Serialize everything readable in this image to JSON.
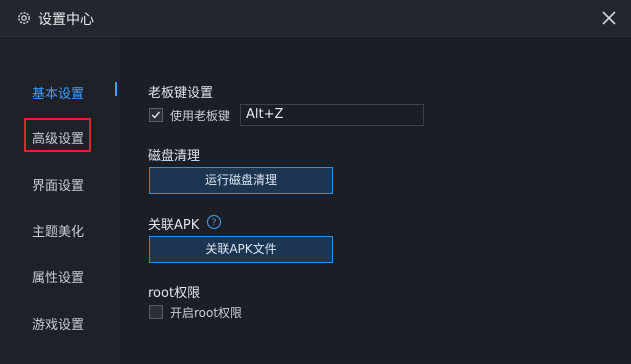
{
  "window": {
    "title": "设置中心",
    "icons": {
      "title": "gear-icon",
      "close": "close-icon"
    }
  },
  "sidebar": {
    "items": [
      {
        "label": "基本设置",
        "active": true
      },
      {
        "label": "高级设置",
        "active": false,
        "highlighted": true
      },
      {
        "label": "界面设置",
        "active": false
      },
      {
        "label": "主题美化",
        "active": false
      },
      {
        "label": "属性设置",
        "active": false
      },
      {
        "label": "游戏设置",
        "active": false
      }
    ]
  },
  "boss_key": {
    "section_title": "老板键设置",
    "checkbox_label": "使用老板键",
    "checked": true,
    "hotkey_value": "Alt+Z"
  },
  "disk_clean": {
    "section_title": "磁盘清理",
    "button_label": "运行磁盘清理"
  },
  "apk": {
    "section_title": "关联APK",
    "help_icon": "question-circle-icon",
    "button_label": "关联APK文件"
  },
  "root": {
    "section_title": "root权限",
    "checkbox_label": "开启root权限",
    "checked": false
  },
  "colors": {
    "accent": "#41a0ff",
    "background": "#1b1e25",
    "highlight_border": "#e0262b",
    "button_border": "#2f8fe8"
  }
}
